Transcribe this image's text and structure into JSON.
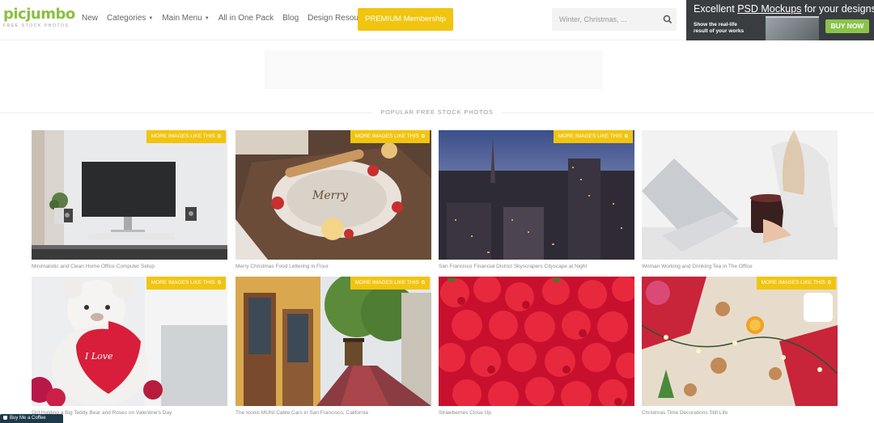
{
  "brand": {
    "logo": "picjumbo",
    "tagline": "FREE STOCK PHOTOS"
  },
  "nav": {
    "items": [
      {
        "label": "New"
      },
      {
        "label": "Categories",
        "dropdown": true
      },
      {
        "label": "Main Menu",
        "dropdown": true
      },
      {
        "label": "All in One Pack"
      },
      {
        "label": "Blog"
      },
      {
        "label": "Design Resources"
      }
    ],
    "premium_label": "PREMIUM Membership"
  },
  "search": {
    "placeholder": "Winter, Christmas, ..."
  },
  "ad": {
    "title_prefix": "Excellent ",
    "title_highlight": "PSD Mockups",
    "title_suffix": " for your designs",
    "subtitle": "Show the real-life result of your works",
    "button": "BUY NOW"
  },
  "section": {
    "title": "POPULAR FREE STOCK PHOTOS"
  },
  "badge_label": "MORE IMAGES LIKE THIS",
  "photos": [
    {
      "caption": "Minimalistic and Clean Home Office Computer Setup",
      "badge": true
    },
    {
      "caption": "Merry Christmas Food Lettering in Flour",
      "badge": true
    },
    {
      "caption": "San Francisco Financial District Skyscrapers Cityscape at Night",
      "badge": true
    },
    {
      "caption": "Woman Working and Drinking Tea in The Office",
      "badge": false
    },
    {
      "caption": "Girl Holding a Big Teddy Bear and Roses on Valentine's Day",
      "badge": true
    },
    {
      "caption": "The Iconic MUNI Cable Cars in San Francisco, California",
      "badge": true
    },
    {
      "caption": "Strawberries Close Up",
      "badge": false
    },
    {
      "caption": "Christmas Time Decorations Still Life",
      "badge": true
    }
  ],
  "coffee": {
    "label": "Buy Me a Coffee"
  },
  "colors": {
    "brand_green": "#8bbf3f",
    "accent_yellow": "#f1c40f"
  }
}
